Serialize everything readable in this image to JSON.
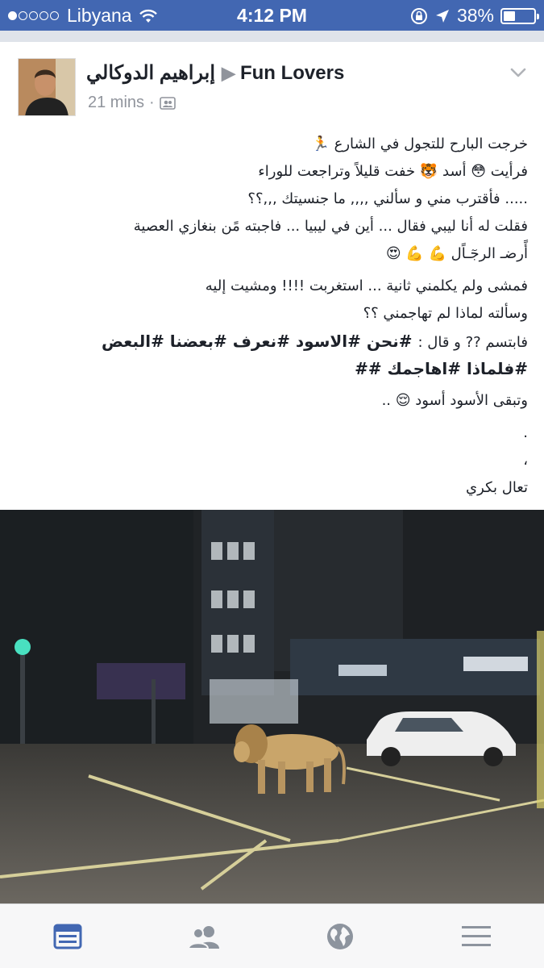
{
  "status_bar": {
    "carrier": "Libyana",
    "time": "4:12 PM",
    "battery_percent": "38%",
    "battery_level": 0.38,
    "signal_bars_filled": 1,
    "signal_bars_total": 5
  },
  "post": {
    "author": "إبراهيم الدوكالي",
    "group": "Fun Lovers",
    "time_ago": "21 mins",
    "separator": "·",
    "icons": [
      "avatar",
      "arrow-right-icon",
      "friends-privacy-icon",
      "chevron-down-icon"
    ],
    "lines": [
      "خرجت البارح للتجول في الشارع",
      "فرأيت",
      "أسد",
      "خفت قليلاً وتراجعت للوراء",
      "..... فأقترب مني و سألني ,,,, ما جنسيتك ,,,؟؟",
      "فقلت له أنا ليبي فقال ... أين في ليبيا ... فاجبته مًن بنغازي العصية",
      "أًرضـ الرجٓـاًل",
      "فمشى ولم يكلمني ثانية ... استغربت !!!! ومشيت إليه",
      "وسألته لماذا لم تهاجمني ؟؟",
      "فابتسم ?? و قال :",
      "#نحن #الاسود #نعرف #بعضنا #البعض",
      "#فلماذا #اهاجمك ##",
      "وتبقى الأسود أسود",
      "..",
      ".",
      "،",
      "تعال بكري"
    ],
    "emojis": {
      "runner": "🏃",
      "flushed": "😳",
      "tiger": "🐯",
      "muscle": "💪",
      "heart_eyes": "😍",
      "relieved": "😌"
    }
  },
  "tab_bar": {
    "items": [
      "news-feed-icon",
      "friends-icon",
      "globe-icon",
      "menu-icon"
    ],
    "active_color": "#4267b2",
    "inactive_color": "#8d949e"
  }
}
